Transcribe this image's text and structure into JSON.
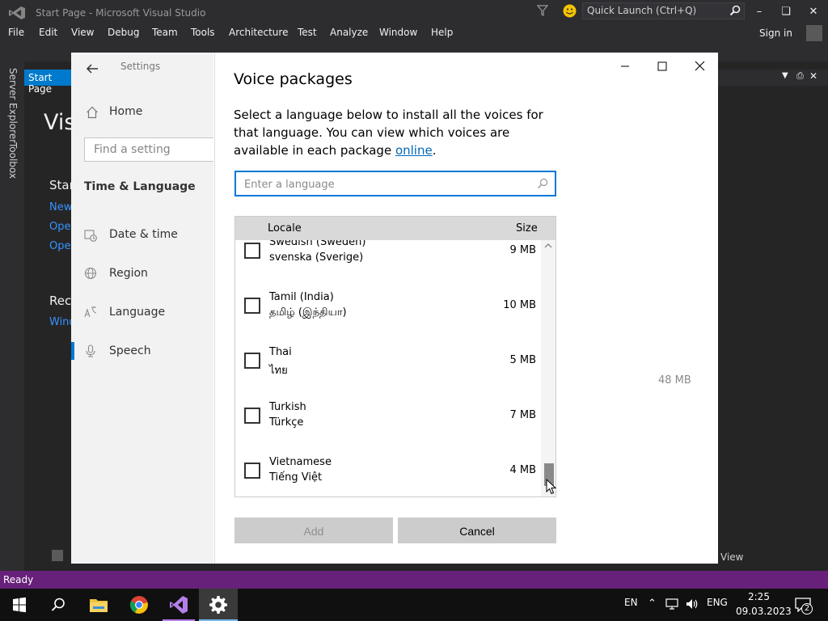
{
  "vs": {
    "title": "Start Page - Microsoft Visual Studio",
    "quick_launch_placeholder": "Quick Launch (Ctrl+Q)",
    "menu": [
      "File",
      "Edit",
      "View",
      "Debug",
      "Team",
      "Tools",
      "Architecture",
      "Test",
      "Analyze",
      "Window",
      "Help"
    ],
    "sign_in": "Sign in",
    "sidebar": [
      "Server Explorer",
      "Toolbox"
    ],
    "tab": "Start Page",
    "bg_texts": {
      "heading": "Vis",
      "start": "Star",
      "new": "New",
      "open1": "Ope",
      "open2": "Ope",
      "recent": "Rece",
      "window": "Wind",
      "view": "View"
    },
    "status": "Ready"
  },
  "taskbar": {
    "lang": "EN",
    "input": "ENG",
    "time": "2:25",
    "date": "09.03.2023",
    "notifications": "2"
  },
  "settings": {
    "nav_title": "Settings",
    "home": "Home",
    "find_placeholder": "Find a setting",
    "section": "Time & Language",
    "items": [
      "Date & time",
      "Region",
      "Language",
      "Speech"
    ],
    "right_size": "48 MB"
  },
  "voice_packages": {
    "title": "Voice packages",
    "description": "Select a language below to install all the voices for that language. You can view which voices are available in each package ",
    "link": "online",
    "search_placeholder": "Enter a language",
    "col_locale": "Locale",
    "col_size": "Size",
    "rows": [
      {
        "name": "Swedish (Sweden)",
        "native": "svenska (Sverige)",
        "size": "9 MB"
      },
      {
        "name": "Tamil (India)",
        "native": "தமிழ் (இந்தியா)",
        "size": "10 MB"
      },
      {
        "name": "Thai",
        "native": "ไทย",
        "size": "5 MB"
      },
      {
        "name": "Turkish",
        "native": "Türkçe",
        "size": "7 MB"
      },
      {
        "name": "Vietnamese",
        "native": "Tiếng Việt",
        "size": "4 MB"
      }
    ],
    "add_label": "Add",
    "cancel_label": "Cancel"
  }
}
